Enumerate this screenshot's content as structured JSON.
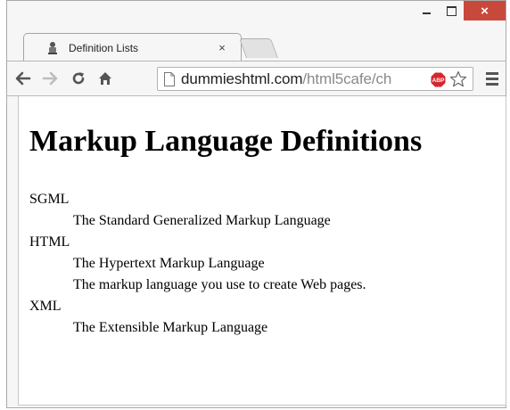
{
  "window": {
    "controls": {
      "minimize": "minimize",
      "maximize": "maximize",
      "close": "×"
    }
  },
  "tab": {
    "title": "Definition Lists",
    "close_glyph": "×"
  },
  "toolbar": {
    "url_host": "dummieshtml.com",
    "url_path": "/html5cafe/ch",
    "icons": [
      "back-icon",
      "forward-icon",
      "reload-icon",
      "home-icon",
      "page-icon",
      "adblock-icon",
      "star-icon",
      "menu-icon"
    ],
    "adblock_label": "ABP"
  },
  "page": {
    "heading": "Markup Language Definitions",
    "definitions": [
      {
        "term": "SGML",
        "descriptions": [
          "The Standard Generalized Markup Language"
        ]
      },
      {
        "term": "HTML",
        "descriptions": [
          "The Hypertext Markup Language",
          "The markup language you use to create Web pages."
        ]
      },
      {
        "term": "XML",
        "descriptions": [
          "The Extensible Markup Language"
        ]
      }
    ]
  },
  "colors": {
    "close_button": "#c9483c",
    "chrome_bg": "#f6f6f6",
    "url_host": "#222222",
    "url_path": "#8a8a8a",
    "adblock_red": "#d8262c"
  }
}
